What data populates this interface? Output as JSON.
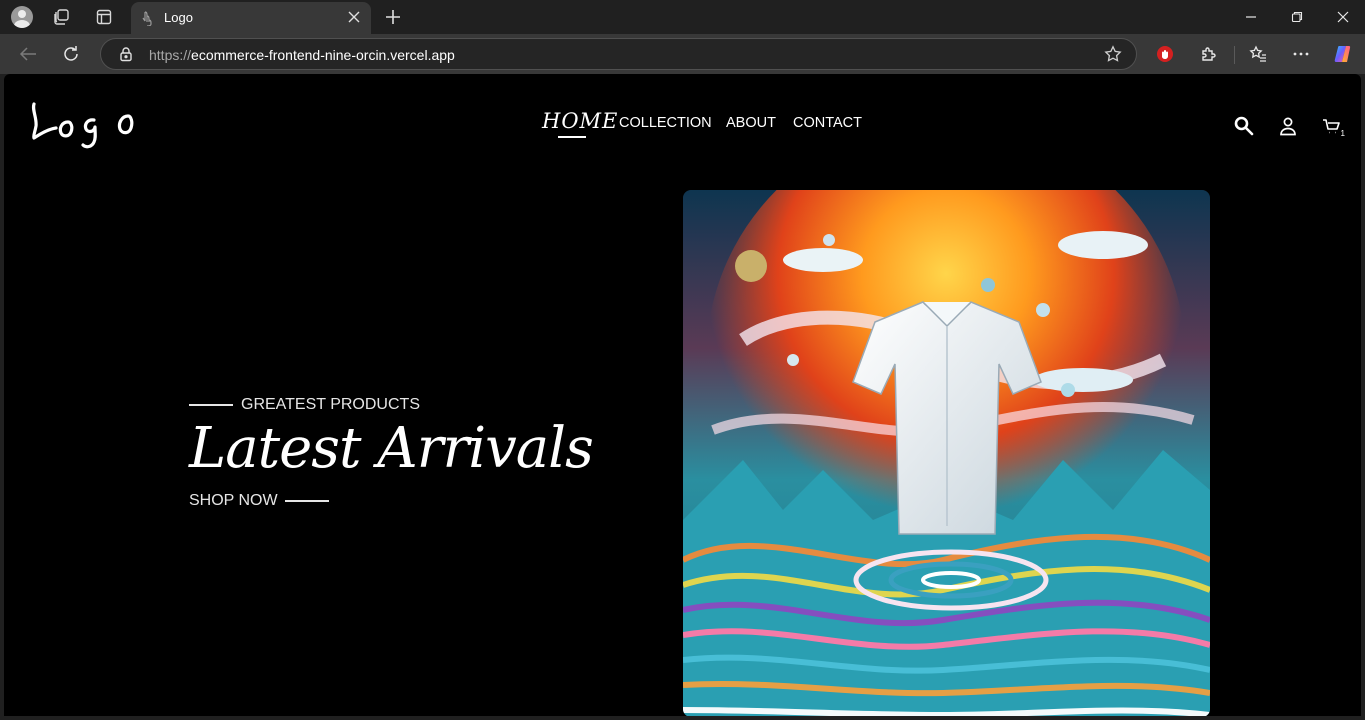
{
  "browser": {
    "tab": {
      "title": "Logo"
    },
    "address": {
      "protocol": "https://",
      "host": "ecommerce-frontend-nine-orcin.vercel.app"
    },
    "icons": [
      "profile-icon",
      "workspaces-icon",
      "tab-actions-icon",
      "close-icon",
      "plus-icon",
      "minimize-icon",
      "restore-icon",
      "back-icon",
      "refresh-icon",
      "lock-icon",
      "star-icon",
      "extension-icon",
      "puzzle-icon",
      "favorites-icon",
      "more-icon",
      "copilot-icon"
    ]
  },
  "site": {
    "logo_text": "Logo",
    "nav": {
      "home": "HOME",
      "collection": "COLLECTION",
      "about": "ABOUT",
      "contact": "CONTACT"
    },
    "cart_count": "1",
    "hero": {
      "subtitle": "GREATEST PRODUCTS",
      "headline": "Latest Arrivals",
      "cta": "SHOP NOW",
      "image_alt": "Hero image"
    }
  },
  "colors": {
    "page_bg": "#000000",
    "text": "#ffffff",
    "chrome_dark": "#202020",
    "chrome_toolbar": "#383838"
  }
}
